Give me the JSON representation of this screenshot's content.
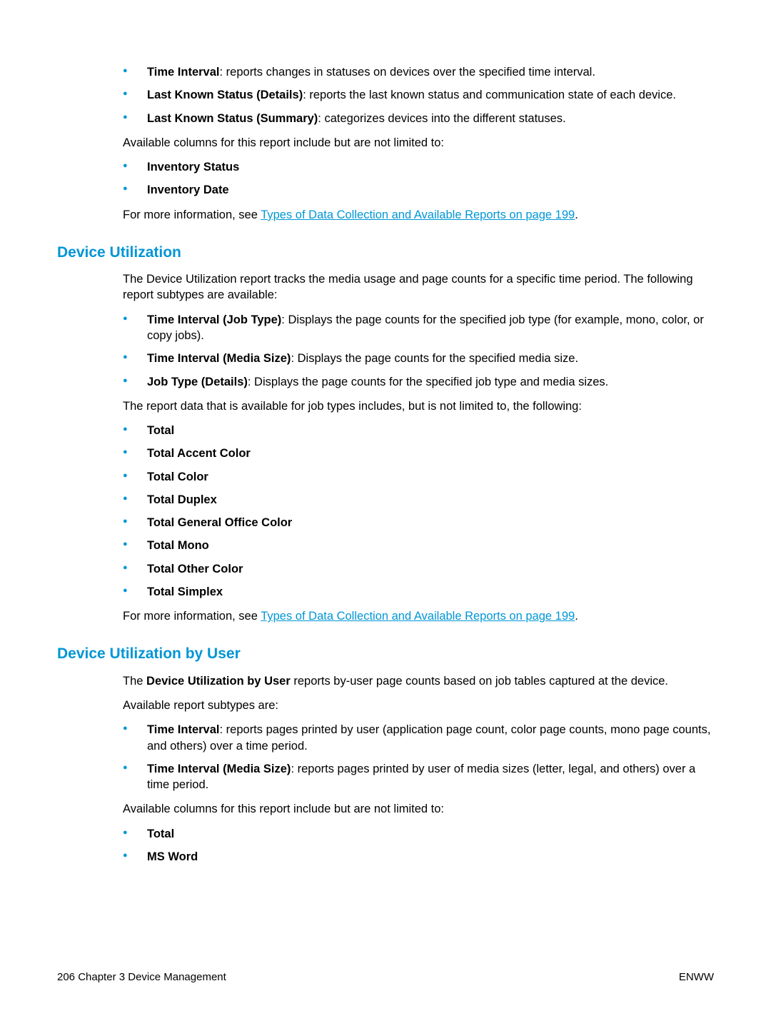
{
  "section1": {
    "items": [
      {
        "term": "Time Interval",
        "desc": ": reports changes in statuses on devices over the specified time interval."
      },
      {
        "term": "Last Known Status (Details)",
        "desc": ": reports the last known status and communication state of each device."
      },
      {
        "term": "Last Known Status (Summary)",
        "desc": ": categorizes devices into the different statuses."
      }
    ],
    "available_cols_intro": "Available columns for this report include but are not limited to:",
    "cols": [
      "Inventory Status",
      "Inventory Date"
    ],
    "for_more_prefix": "For more information, see ",
    "link_text": "Types of Data Collection and Available Reports on page 199",
    "for_more_suffix": "."
  },
  "section2": {
    "heading": "Device Utilization",
    "intro": "The Device Utilization report tracks the media usage and page counts for a specific time period. The following report subtypes are available:",
    "items": [
      {
        "term": "Time Interval (Job Type)",
        "desc": ": Displays the page counts for the specified job type (for example, mono, color, or copy jobs)."
      },
      {
        "term": "Time Interval (Media Size)",
        "desc": ": Displays the page counts for the specified media size."
      },
      {
        "term": "Job Type (Details)",
        "desc": ": Displays the page counts for the specified job type and media sizes."
      }
    ],
    "jobtypes_intro": "The report data that is available for job types includes, but is not limited to, the following:",
    "jobtypes": [
      "Total",
      "Total Accent Color",
      "Total Color",
      "Total Duplex",
      "Total General Office Color",
      "Total Mono",
      "Total Other Color",
      "Total Simplex"
    ],
    "for_more_prefix": "For more information, see ",
    "link_text": "Types of Data Collection and Available Reports on page 199",
    "for_more_suffix": "."
  },
  "section3": {
    "heading": "Device Utilization by User",
    "intro_pre": "The ",
    "intro_bold": "Device Utilization by User",
    "intro_post": " reports by-user page counts based on job tables captured at the device.",
    "subtypes_intro": "Available report subtypes are:",
    "items": [
      {
        "term": "Time Interval",
        "desc": ": reports pages printed by user (application page count, color page counts, mono page counts, and others) over a time period."
      },
      {
        "term": "Time Interval (Media Size)",
        "desc": ": reports pages printed by user of media sizes (letter, legal, and others) over a time period."
      }
    ],
    "cols_intro": "Available columns for this report include but are not limited to:",
    "cols": [
      "Total",
      "MS Word"
    ]
  },
  "footer": {
    "left": "206   Chapter 3   Device Management",
    "right": "ENWW"
  }
}
